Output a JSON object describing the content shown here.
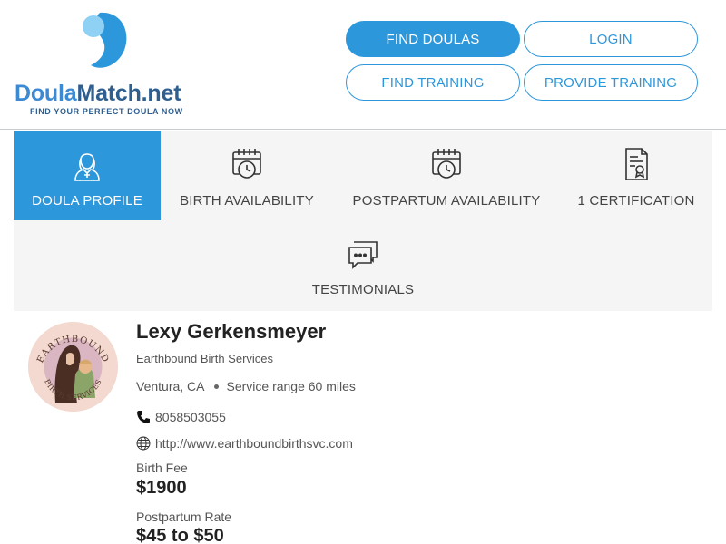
{
  "header": {
    "logo": {
      "word_part1": "Doula",
      "word_part2": "Match.net",
      "tagline": "FIND YOUR PERFECT DOULA NOW"
    },
    "nav": {
      "find_doulas": "FIND DOULAS",
      "login": "LOGIN",
      "find_training": "FIND TRAINING",
      "provide_training": "PROVIDE TRAINING"
    }
  },
  "tabs": [
    {
      "label": "DOULA PROFILE",
      "icon": "doula-person-icon",
      "active": true
    },
    {
      "label": "BIRTH AVAILABILITY",
      "icon": "calendar-clock-icon",
      "active": false
    },
    {
      "label": "POSTPARTUM AVAILABILITY",
      "icon": "calendar-clock-icon",
      "active": false
    },
    {
      "label": "1 CERTIFICATION",
      "icon": "certificate-icon",
      "active": false
    },
    {
      "label": "TESTIMONIALS",
      "icon": "chat-bubbles-icon",
      "active": false
    }
  ],
  "profile": {
    "logo_text_top": "EARTHBOUND",
    "logo_text_bottom": "BIRTH SERVICES",
    "name": "Lexy Gerkensmeyer",
    "business": "Earthbound Birth Services",
    "location": "Ventura, CA",
    "service_range": "Service range 60 miles",
    "phone": "8058503055",
    "website": "http://www.earthboundbirthsvc.com",
    "birth_fee_label": "Birth Fee",
    "birth_fee": "$1900",
    "postpartum_rate_label": "Postpartum Rate",
    "postpartum_rate": "$45 to $50"
  },
  "colors": {
    "accent": "#2d97db",
    "logo_dark": "#2f5f8f",
    "tab_bg": "#f5f5f5"
  }
}
